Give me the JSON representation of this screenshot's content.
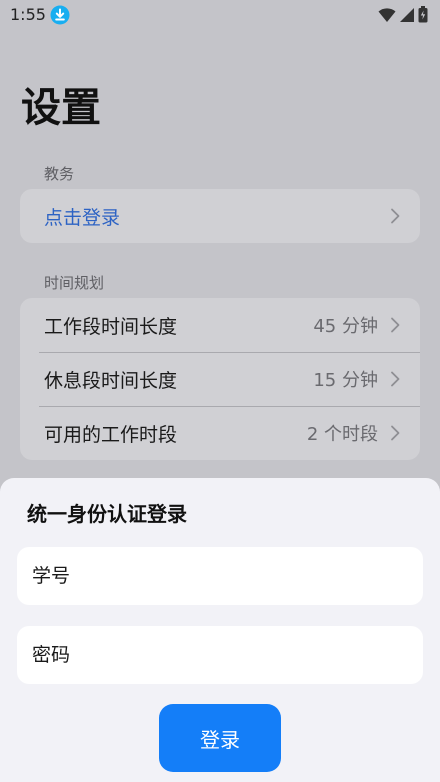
{
  "status_bar": {
    "time": "1:55",
    "icons": [
      "download-icon",
      "wifi-icon",
      "cellular-signal-icon",
      "battery-charging-icon"
    ]
  },
  "page": {
    "title": "设置"
  },
  "sections": [
    {
      "header": "教务",
      "rows": [
        {
          "label": "点击登录",
          "value": ""
        }
      ]
    },
    {
      "header": "时间规划",
      "rows": [
        {
          "label": "工作段时间长度",
          "value": "45 分钟"
        },
        {
          "label": "休息段时间长度",
          "value": "15 分钟"
        },
        {
          "label": "可用的工作时段",
          "value": "2 个时段"
        }
      ]
    }
  ],
  "login_sheet": {
    "title": "统一身份认证登录",
    "student_id": {
      "placeholder": "学号",
      "value": ""
    },
    "password": {
      "placeholder": "密码",
      "value": ""
    },
    "submit_label": "登录"
  },
  "colors": {
    "accent": "#147ef8",
    "link": "#2d63c4",
    "dimmed_background": "#c4c4c9",
    "sheet_background": "#f2f2f7"
  }
}
